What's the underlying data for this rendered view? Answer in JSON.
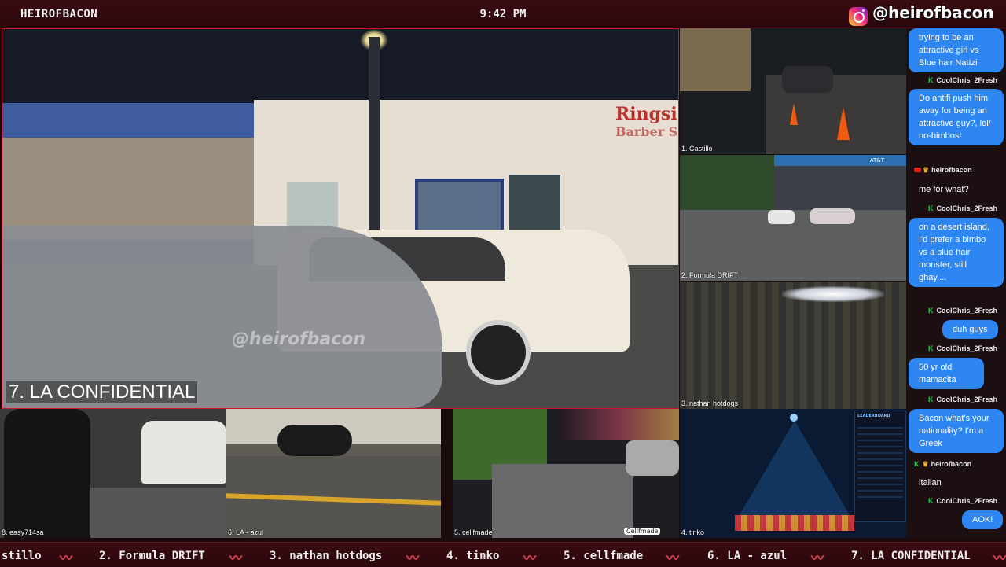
{
  "header": {
    "brand": "HEIROFBACON",
    "clock": "9:42 PM",
    "instagram_handle": "@heirofbacon"
  },
  "main_feed": {
    "store_sign": "Ringsi\nBarber S",
    "watermark": "@heirofbacon",
    "caption": "7. LA CONFIDENTIAL"
  },
  "side_feeds": [
    {
      "label": "1. Castillo"
    },
    {
      "label": "2. Formula DRIFT"
    },
    {
      "label": "3. nathan hotdogs"
    },
    {
      "label": "4. tinko"
    }
  ],
  "bottom_feeds": [
    {
      "label": "8. easy714sa"
    },
    {
      "label": "6. LA - azul"
    },
    {
      "label": "5. cellfmade"
    }
  ],
  "overlay_text": {
    "cellfmade_tag": "Cellfmade",
    "drift_banner": "AT&T",
    "leaderboard_title": "LEADERBOARD"
  },
  "chat": {
    "messages": [
      {
        "type": "bubble",
        "text": "trying to be an attractive girl vs Blue hair Nattzi"
      },
      {
        "type": "user",
        "badge": "K",
        "name": "CoolChris_2Fresh"
      },
      {
        "type": "bubble",
        "text": "Do antifi push him away for being an attractive guy?, lol/ no-bimbos!"
      },
      {
        "type": "user",
        "badge": "yt",
        "name": "heirofbacon"
      },
      {
        "type": "plain",
        "text": "me for what?"
      },
      {
        "type": "user",
        "badge": "K",
        "name": "CoolChris_2Fresh"
      },
      {
        "type": "bubble",
        "text": "on a desert island, I'd prefer a bimbo vs a blue hair monster, still ghay...."
      },
      {
        "type": "user",
        "badge": "K",
        "name": "CoolChris_2Fresh"
      },
      {
        "type": "bubble",
        "text": "duh guys"
      },
      {
        "type": "user",
        "badge": "K",
        "name": "CoolChris_2Fresh"
      },
      {
        "type": "bubble",
        "text": "50 yr old mamacita"
      },
      {
        "type": "user",
        "badge": "K",
        "name": "CoolChris_2Fresh"
      },
      {
        "type": "bubble",
        "text": "Bacon what's your nationality? I'm a Greek"
      },
      {
        "type": "user",
        "badge": "K",
        "name": "heirofbacon"
      },
      {
        "type": "plain",
        "text": "italian"
      },
      {
        "type": "user",
        "badge": "K",
        "name": "CoolChris_2Fresh"
      },
      {
        "type": "bubble",
        "text": "AOK!"
      }
    ]
  },
  "ticker": {
    "items": [
      "stillo",
      "2. Formula DRIFT",
      "3. nathan hotdogs",
      "4. tinko",
      "5. cellfmade",
      "6. LA - azul",
      "7. LA CONFIDENTIAL"
    ],
    "separator_icon": "bacon-icon"
  },
  "colors": {
    "accent": "#c41b2a",
    "chat_bubble": "#2e86f2",
    "bar_bg": "#2a070c"
  }
}
